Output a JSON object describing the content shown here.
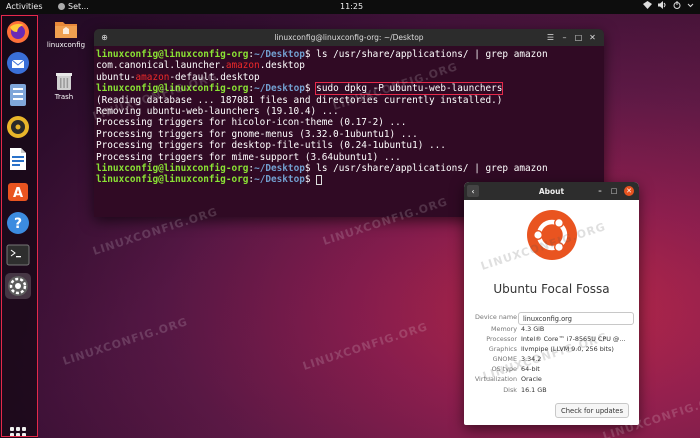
{
  "topbar": {
    "activities": "Activities",
    "app_menu": "Set...",
    "clock": "11:25",
    "tray_icons": [
      "network-icon",
      "volume-icon",
      "power-icon",
      "chevron-down-icon"
    ]
  },
  "dock": {
    "items": [
      {
        "name": "firefox-icon",
        "color": "#ff7139"
      },
      {
        "name": "thunderbird-icon",
        "color": "#3a6fd8"
      },
      {
        "name": "files-icon",
        "color": "#6a8fc9"
      },
      {
        "name": "rhythmbox-icon",
        "color": "#e0a821"
      },
      {
        "name": "libreoffice-writer-icon",
        "color": "#2a72c9"
      },
      {
        "name": "software-center-icon",
        "color": "#e95420"
      },
      {
        "name": "help-icon",
        "color": "#3c8be0"
      },
      {
        "name": "terminal-icon",
        "color": "#2e2e2e"
      },
      {
        "name": "settings-icon",
        "color": "#606060"
      }
    ]
  },
  "desktop_icons": {
    "home": "linuxconfig",
    "trash": "Trash"
  },
  "terminal": {
    "title": "linuxconfig@linuxconfig-org: ~/Desktop",
    "user": "linuxconfig@linuxconfig-org",
    "sep": ":",
    "path": "~/Desktop",
    "prompt_end": "$ ",
    "cmd1": "ls /usr/share/applications/ | grep amazon",
    "out1_pre": "com.canonical.launcher.",
    "out1_hl": "amazon",
    "out1_post": ".desktop",
    "out2_pre": "ubuntu-",
    "out2_hl": "amazon",
    "out2_post": "-default.desktop",
    "cmd2": "sudo dpkg -P ubuntu-web-launchers",
    "out3": "(Reading database ... 187081 files and directories currently installed.)",
    "out4": "Removing ubuntu-web-launchers (19.10.4) ...",
    "out5": "Processing triggers for hicolor-icon-theme (0.17-2) ...",
    "out6": "Processing triggers for gnome-menus (3.32.0-1ubuntu1) ...",
    "out7": "Processing triggers for desktop-file-utils (0.24-1ubuntu1) ...",
    "out8": "Processing triggers for mime-support (3.64ubuntu1) ...",
    "cmd3": "ls /usr/share/applications/ | grep amazon"
  },
  "about": {
    "title": "About",
    "distro": "Ubuntu Focal Fossa",
    "device_name_label": "Device name",
    "device_name_value": "linuxconfig.org",
    "rows": [
      {
        "label": "Memory",
        "value": "4.3 GiB"
      },
      {
        "label": "Processor",
        "value": "Intel® Core™ i7-8565U CPU @..."
      },
      {
        "label": "Graphics",
        "value": "llvmpipe (LLVM 9.0, 256 bits)"
      },
      {
        "label": "GNOME",
        "value": "3.34.2"
      },
      {
        "label": "OS type",
        "value": "64-bit"
      },
      {
        "label": "Virtualization",
        "value": "Oracle"
      },
      {
        "label": "Disk",
        "value": "16.1 GB"
      }
    ],
    "updates_button": "Check for updates"
  },
  "watermark": "LINUXCONFIG.ORG",
  "colors": {
    "accent": "#e95420",
    "highlight_box": "#e5294a",
    "terminal_bg": "#300a24",
    "prompt_user": "#8ae234",
    "prompt_path": "#729fcf"
  }
}
